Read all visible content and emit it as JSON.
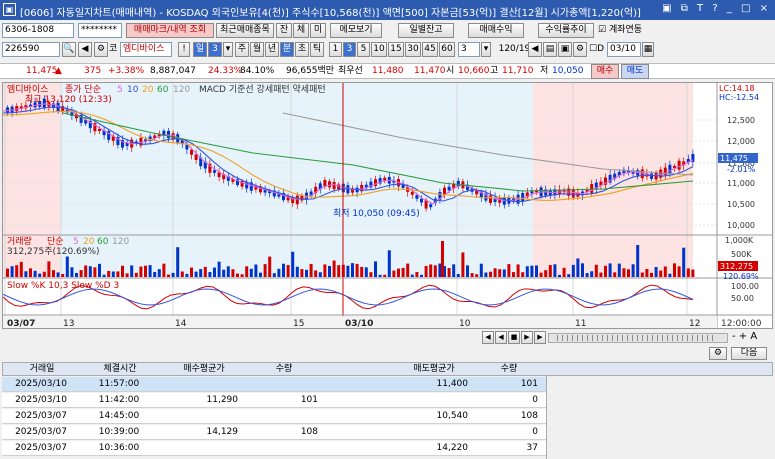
{
  "title": "[0606] 자동일지차트(매매내역) - KOSDAQ 외국인보유[4(천)] 주식수[10,568(천)] 액면[500] 자본금[53(억)] 결산[12월] 시가총액[1,220(억)]",
  "win_buttons": "▣ ⧉ T ? _ □ ×",
  "toolbar1": {
    "account": "6306-1808",
    "password": "********",
    "b_mark": "매매마크/내역 조회",
    "b_recent": "최근매매종목",
    "b_jan": "잔",
    "b_che": "체",
    "b_mi": "미",
    "b_memo": "메모보기",
    "b_daily": "일별잔고",
    "b_profit": "매매수익",
    "b_trend": "수익률추이",
    "chk_account": "계좌연동"
  },
  "toolbar2": {
    "code": "226590",
    "market": "코",
    "stock": "엠디바이스",
    "warn": "!",
    "day": "일",
    "day_num": "3",
    "periods": [
      "주",
      "월",
      "년",
      "분",
      "초",
      "틱"
    ],
    "nums": [
      "1",
      "3",
      "5",
      "10",
      "15",
      "30",
      "45",
      "60"
    ],
    "n3": "3",
    "count": "120/190",
    "chk_d": "D",
    "date": "03/10"
  },
  "quote": {
    "price": "11,475",
    "arrow": "▲",
    "diff": "375",
    "pct": "+3.38%",
    "volume": "8,887,047",
    "rate1": "24.33%",
    "rate2": "84.10%",
    "amount": "96,655백만",
    "hoga_label": "최우선",
    "ask": "11,480",
    "bid": "11,470",
    "open_label": "시",
    "open": "10,660",
    "high_label": "고",
    "high": "11,710",
    "low_label": "저",
    "low": "10,050",
    "buy": "매수",
    "sell": "매도"
  },
  "chart": {
    "stock_tag": "엠디바이스",
    "price_legend": "종가 단순",
    "ma": [
      "5",
      "10",
      "20",
      "60",
      "120"
    ],
    "extra": "MACD 기준선 강세패턴 약세패턴",
    "high_note": "최고 13,120 (12:33)",
    "low_note": "최저 10,050 (09:45)",
    "lc": "LC:14.18",
    "hc": "HC:-12.54",
    "price_ticks": [
      "12,500",
      "12,000",
      "11,500",
      "11,000",
      "10,500",
      "10,000"
    ],
    "cur_price": "11,475",
    "cur_pct": "-2.01%",
    "vol_label": "거래량",
    "vol_ma_label": "단순",
    "vol_ma": [
      "5",
      "20",
      "60",
      "120"
    ],
    "vol_value": "312,275주(120.69%)",
    "vol_ticks": [
      "1,000K",
      "500K"
    ],
    "vol_badge": "312,275",
    "vol_pct": "120.69%",
    "stoch_label": "Slow %K 10,3  Slow %D 3",
    "stoch_ticks": [
      "100.00",
      "50.00"
    ],
    "x_labels": [
      "03/07",
      "13",
      "14",
      "15",
      "03/10",
      "10",
      "11",
      "12"
    ],
    "x_end": "12:00:00"
  },
  "nav_buttons": [
    "◀",
    "◀",
    "■",
    "▶",
    "▶"
  ],
  "scroll": "- + A",
  "next_btn": "다음",
  "table": {
    "headers": [
      "거래일",
      "체결시간",
      "매수평균가",
      "수량",
      "",
      "매도평균가",
      "수량"
    ],
    "rows": [
      [
        "2025/03/10",
        "11:57:00",
        "",
        "",
        "",
        "11,400",
        "101"
      ],
      [
        "2025/03/10",
        "11:42:00",
        "11,290",
        "101",
        "",
        "",
        "0"
      ],
      [
        "2025/03/07",
        "14:45:00",
        "",
        "",
        "",
        "10,540",
        "108"
      ],
      [
        "2025/03/07",
        "10:39:00",
        "14,129",
        "108",
        "",
        "",
        "0"
      ],
      [
        "2025/03/07",
        "10:36:00",
        "",
        "",
        "",
        "14,220",
        "37"
      ]
    ]
  },
  "colors": {
    "up": "#d40000",
    "down": "#0033cc",
    "ma5": "#e066e0",
    "ma10": "#3355dd",
    "ma20": "#f0a020",
    "ma60": "#2a9a3a",
    "ma120": "#999999"
  }
}
